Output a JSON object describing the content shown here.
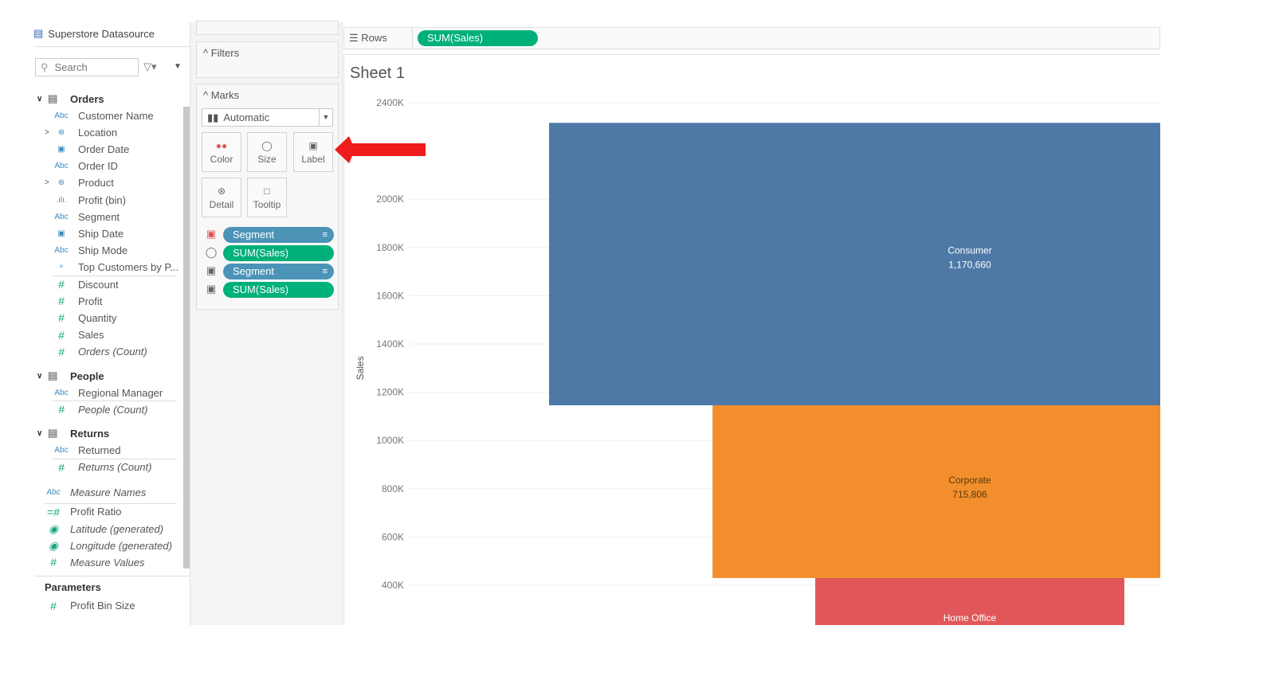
{
  "datasource": {
    "name": "Superstore Datasource",
    "search_placeholder": "Search"
  },
  "tables": [
    {
      "name": "Orders",
      "fields": [
        {
          "type": "Abc",
          "name": "Customer Name"
        },
        {
          "type": "hierarchy",
          "name": "Location",
          "expandable": true
        },
        {
          "type": "date",
          "name": "Order Date"
        },
        {
          "type": "Abc",
          "name": "Order ID"
        },
        {
          "type": "hierarchy",
          "name": "Product",
          "expandable": true
        },
        {
          "type": "bin",
          "name": "Profit (bin)"
        },
        {
          "type": "Abc",
          "name": "Segment"
        },
        {
          "type": "date",
          "name": "Ship Date"
        },
        {
          "type": "Abc",
          "name": "Ship Mode"
        },
        {
          "type": "set",
          "name": "Top Customers by P..."
        }
      ],
      "measures": [
        {
          "name": "Discount"
        },
        {
          "name": "Profit"
        },
        {
          "name": "Quantity"
        },
        {
          "name": "Sales"
        },
        {
          "name": "Orders (Count)",
          "italic": true
        }
      ]
    },
    {
      "name": "People",
      "fields": [
        {
          "type": "Abc",
          "name": "Regional Manager"
        }
      ],
      "measures": [
        {
          "name": "People (Count)",
          "italic": true
        }
      ]
    },
    {
      "name": "Returns",
      "fields": [
        {
          "type": "Abc",
          "name": "Returned"
        }
      ],
      "measures": [
        {
          "name": "Returns (Count)",
          "italic": true
        }
      ]
    }
  ],
  "extra_fields": [
    {
      "type": "Abc",
      "name": "Measure Names",
      "italic": true
    }
  ],
  "extra_measures": [
    {
      "type": "calc",
      "name": "Profit Ratio"
    },
    {
      "type": "geo",
      "name": "Latitude (generated)",
      "italic": true
    },
    {
      "type": "geo",
      "name": "Longitude (generated)",
      "italic": true
    },
    {
      "type": "measure",
      "name": "Measure Values",
      "italic": true
    }
  ],
  "parameters": {
    "title": "Parameters",
    "items": [
      {
        "name": "Profit Bin Size"
      }
    ]
  },
  "filters": {
    "title": "Filters"
  },
  "marks": {
    "title": "Marks",
    "type": "Automatic",
    "buttons": [
      "Color",
      "Size",
      "Label",
      "Detail",
      "Tooltip"
    ],
    "pills": [
      {
        "icon": "color",
        "label": "Segment",
        "kind": "dimension"
      },
      {
        "icon": "size",
        "label": "SUM(Sales)",
        "kind": "measure"
      },
      {
        "icon": "label",
        "label": "Segment",
        "kind": "dimension"
      },
      {
        "icon": "label",
        "label": "SUM(Sales)",
        "kind": "measure"
      }
    ]
  },
  "rows_shelf": {
    "label": "Rows",
    "pill": "SUM(Sales)"
  },
  "annotation": {
    "arrow_color": "#ee1c1c",
    "points_to": "Label"
  },
  "chart_data": {
    "type": "bar",
    "title": "Sheet 1",
    "ylabel": "Sales",
    "ylim": [
      0,
      2400000
    ],
    "yticks": [
      "2400K",
      "2000K",
      "1800K",
      "1600K",
      "1400K",
      "1200K",
      "1000K",
      "800K",
      "600K",
      "400K"
    ],
    "ytick_values": [
      2400000,
      2000000,
      1800000,
      1600000,
      1400000,
      1200000,
      1000000,
      800000,
      600000,
      400000
    ],
    "stacked": true,
    "size_encodes": "SUM(Sales)",
    "grid": true,
    "series": [
      {
        "name": "Consumer",
        "value": 1170660,
        "label": "1,170,660",
        "color": "#4e79a7"
      },
      {
        "name": "Corporate",
        "value": 715806,
        "label": "715,806",
        "color": "#f28e2b"
      },
      {
        "name": "Home Office",
        "value": 430000,
        "label": "",
        "color": "#e15759"
      }
    ]
  }
}
